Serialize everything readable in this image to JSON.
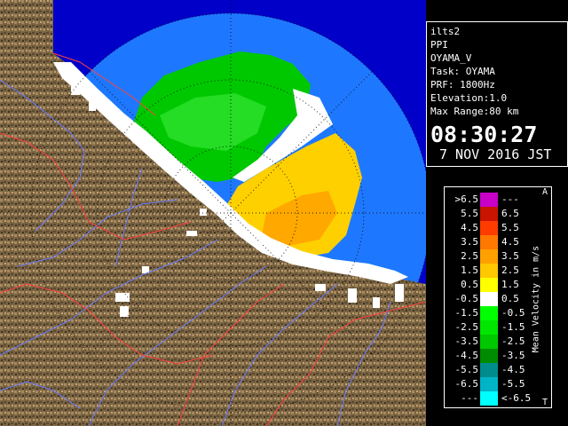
{
  "info": {
    "lines": [
      "ilts2",
      "PPI",
      "OYAMA_V",
      "Task: OYAMA",
      "PRF: 1800Hz",
      "Elevation:1.0",
      "Max Range:80 km"
    ],
    "time": "08:30:27",
    "date": "7 NOV 2016 JST"
  },
  "legend": {
    "title": "Mean Velocity in m/s",
    "top_marker": "A",
    "bottom_marker": "T",
    "rows": [
      {
        "left": ">6.5",
        "color": "#c800c8",
        "right": "---"
      },
      {
        "left": "5.5",
        "color": "#c81400",
        "right": "6.5"
      },
      {
        "left": "4.5",
        "color": "#ff3c00",
        "right": "5.5"
      },
      {
        "left": "3.5",
        "color": "#ff7800",
        "right": "4.5"
      },
      {
        "left": "2.5",
        "color": "#ffa000",
        "right": "3.5"
      },
      {
        "left": "1.5",
        "color": "#ffc800",
        "right": "2.5"
      },
      {
        "left": "0.5",
        "color": "#ffff00",
        "right": "1.5"
      },
      {
        "left": "-0.5",
        "color": "#ffffff",
        "right": "0.5"
      },
      {
        "left": "-1.5",
        "color": "#00ff00",
        "right": "-0.5"
      },
      {
        "left": "-2.5",
        "color": "#00e600",
        "right": "-1.5"
      },
      {
        "left": "-3.5",
        "color": "#00c800",
        "right": "-2.5"
      },
      {
        "left": "-4.5",
        "color": "#008c00",
        "right": "-3.5"
      },
      {
        "left": "-5.5",
        "color": "#008c8c",
        "right": "-4.5"
      },
      {
        "left": "-6.5",
        "color": "#00b4c8",
        "right": "-5.5"
      },
      {
        "left": "---",
        "color": "#00ffff",
        "right": "<-6.5"
      }
    ]
  },
  "map": {
    "colors": {
      "sea": "#0000c8",
      "radar_range": "#1e78ff",
      "land": "#7a6442",
      "land_light": "#b09068",
      "rivers": "#6a7cff",
      "boundaries": "#ff4040",
      "ground_clutter": "#ffffff",
      "approaching": "#00c800",
      "receding": "#ffd000"
    }
  }
}
